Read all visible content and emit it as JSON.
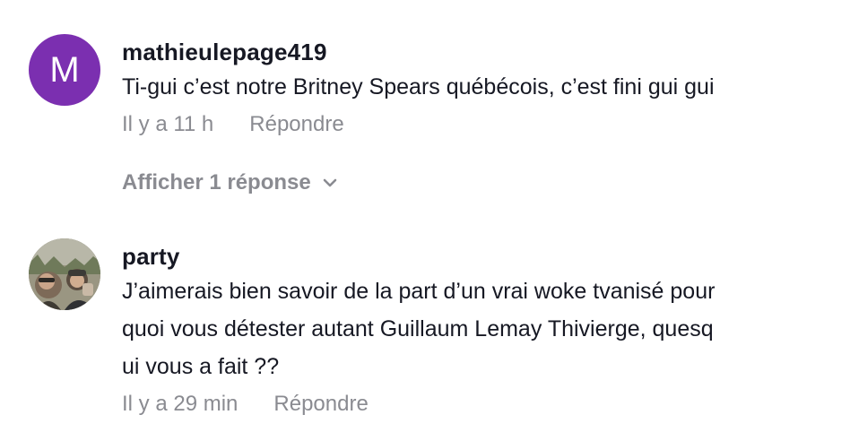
{
  "comments": [
    {
      "avatar_letter": "M",
      "avatar_color": "#7b2fb0",
      "username": "mathieulepage419",
      "text": "Ti-gui c’est notre Britney Spears québécois, c’est fini gui gui",
      "time": "Il y a 11 h",
      "reply_label": "Répondre"
    },
    {
      "username": "party",
      "text_lines": [
        "J’aimerais bien savoir de la part d’un vrai woke tvanisé pour",
        "quoi vous détester autant Guillaum Lemay Thivierge, quesq",
        "ui vous a fait ??"
      ],
      "time": "Il y a 29 min",
      "reply_label": "Répondre"
    }
  ],
  "view_replies_label": "Afficher 1 réponse",
  "icons": {
    "view_replies": "chevron-down-icon"
  }
}
